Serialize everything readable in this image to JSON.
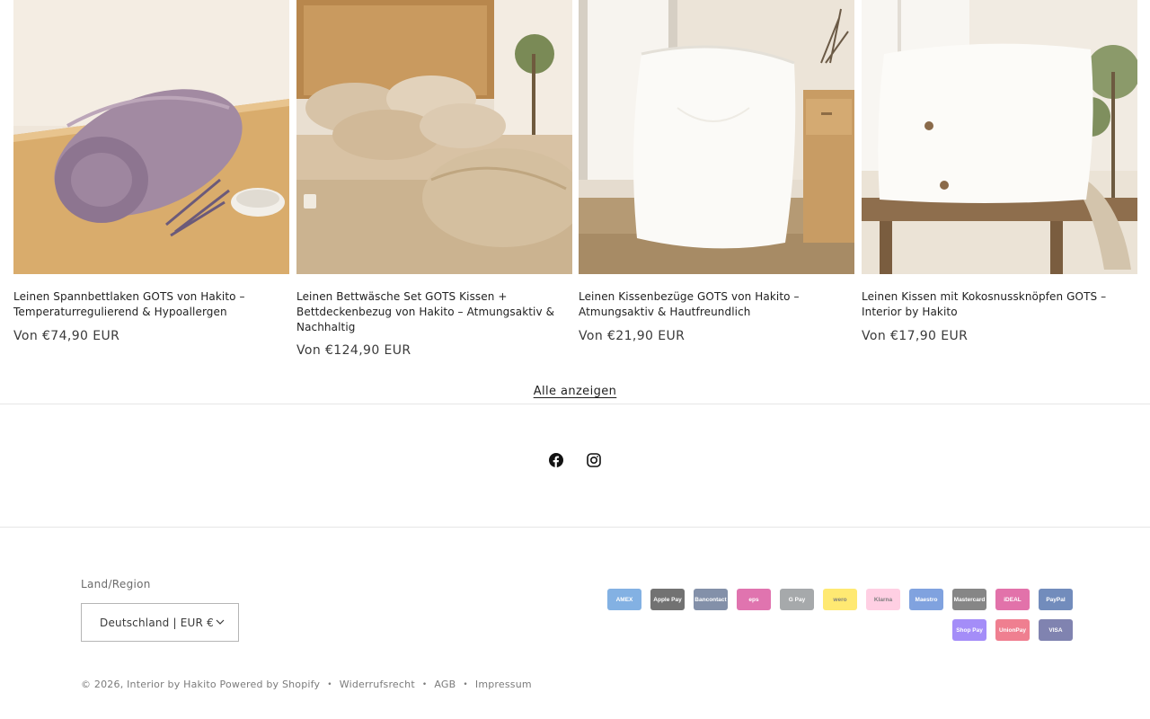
{
  "products": [
    {
      "title": "Leinen Spannbettlaken GOTS von Hakito – Temperaturregulierend & Hypoallergen",
      "price": "Von €74,90 EUR"
    },
    {
      "title": "Leinen Bettwäsche Set GOTS Kissen + Bettdeckenbezug von Hakito – Atmungsaktiv & Nachhaltig",
      "price": "Von €124,90 EUR"
    },
    {
      "title": "Leinen Kissenbezüge GOTS von Hakito – Atmungsaktiv & Hautfreundlich",
      "price": "Von €21,90 EUR"
    },
    {
      "title": "Leinen Kissen mit Kokosnussknöpfen GOTS – Interior by Hakito",
      "price": "Von €17,90 EUR"
    }
  ],
  "view_all": "Alle anzeigen",
  "social": {
    "facebook_icon": "facebook-icon",
    "instagram_icon": "instagram-icon"
  },
  "localization": {
    "label": "Land/Region",
    "value": "Deutschland | EUR €"
  },
  "payments": [
    {
      "name": "AMEX",
      "color": "#1f72cd"
    },
    {
      "name": "Apple Pay",
      "color": "#000000"
    },
    {
      "name": "Bancontact",
      "color": "#1e3764"
    },
    {
      "name": "eps",
      "color": "#c8036f"
    },
    {
      "name": "G Pay",
      "color": "#5f6368"
    },
    {
      "name": "wero",
      "color": "#ffd800"
    },
    {
      "name": "Klarna",
      "color": "#ffa8cd"
    },
    {
      "name": "Maestro",
      "color": "#1a57c5"
    },
    {
      "name": "Mastercard",
      "color": "#252525"
    },
    {
      "name": "iDEAL",
      "color": "#cc0066"
    },
    {
      "name": "PayPal",
      "color": "#003087"
    },
    {
      "name": "Shop Pay",
      "color": "#5a31f4"
    },
    {
      "name": "UnionPay",
      "color": "#e21836"
    },
    {
      "name": "VISA",
      "color": "#1a1f71"
    }
  ],
  "footer": {
    "copyright": "© 2026,",
    "store": "Interior by Hakito",
    "powered": "Powered by Shopify",
    "links": [
      "Widerrufsrecht",
      "AGB",
      "Impressum"
    ]
  }
}
